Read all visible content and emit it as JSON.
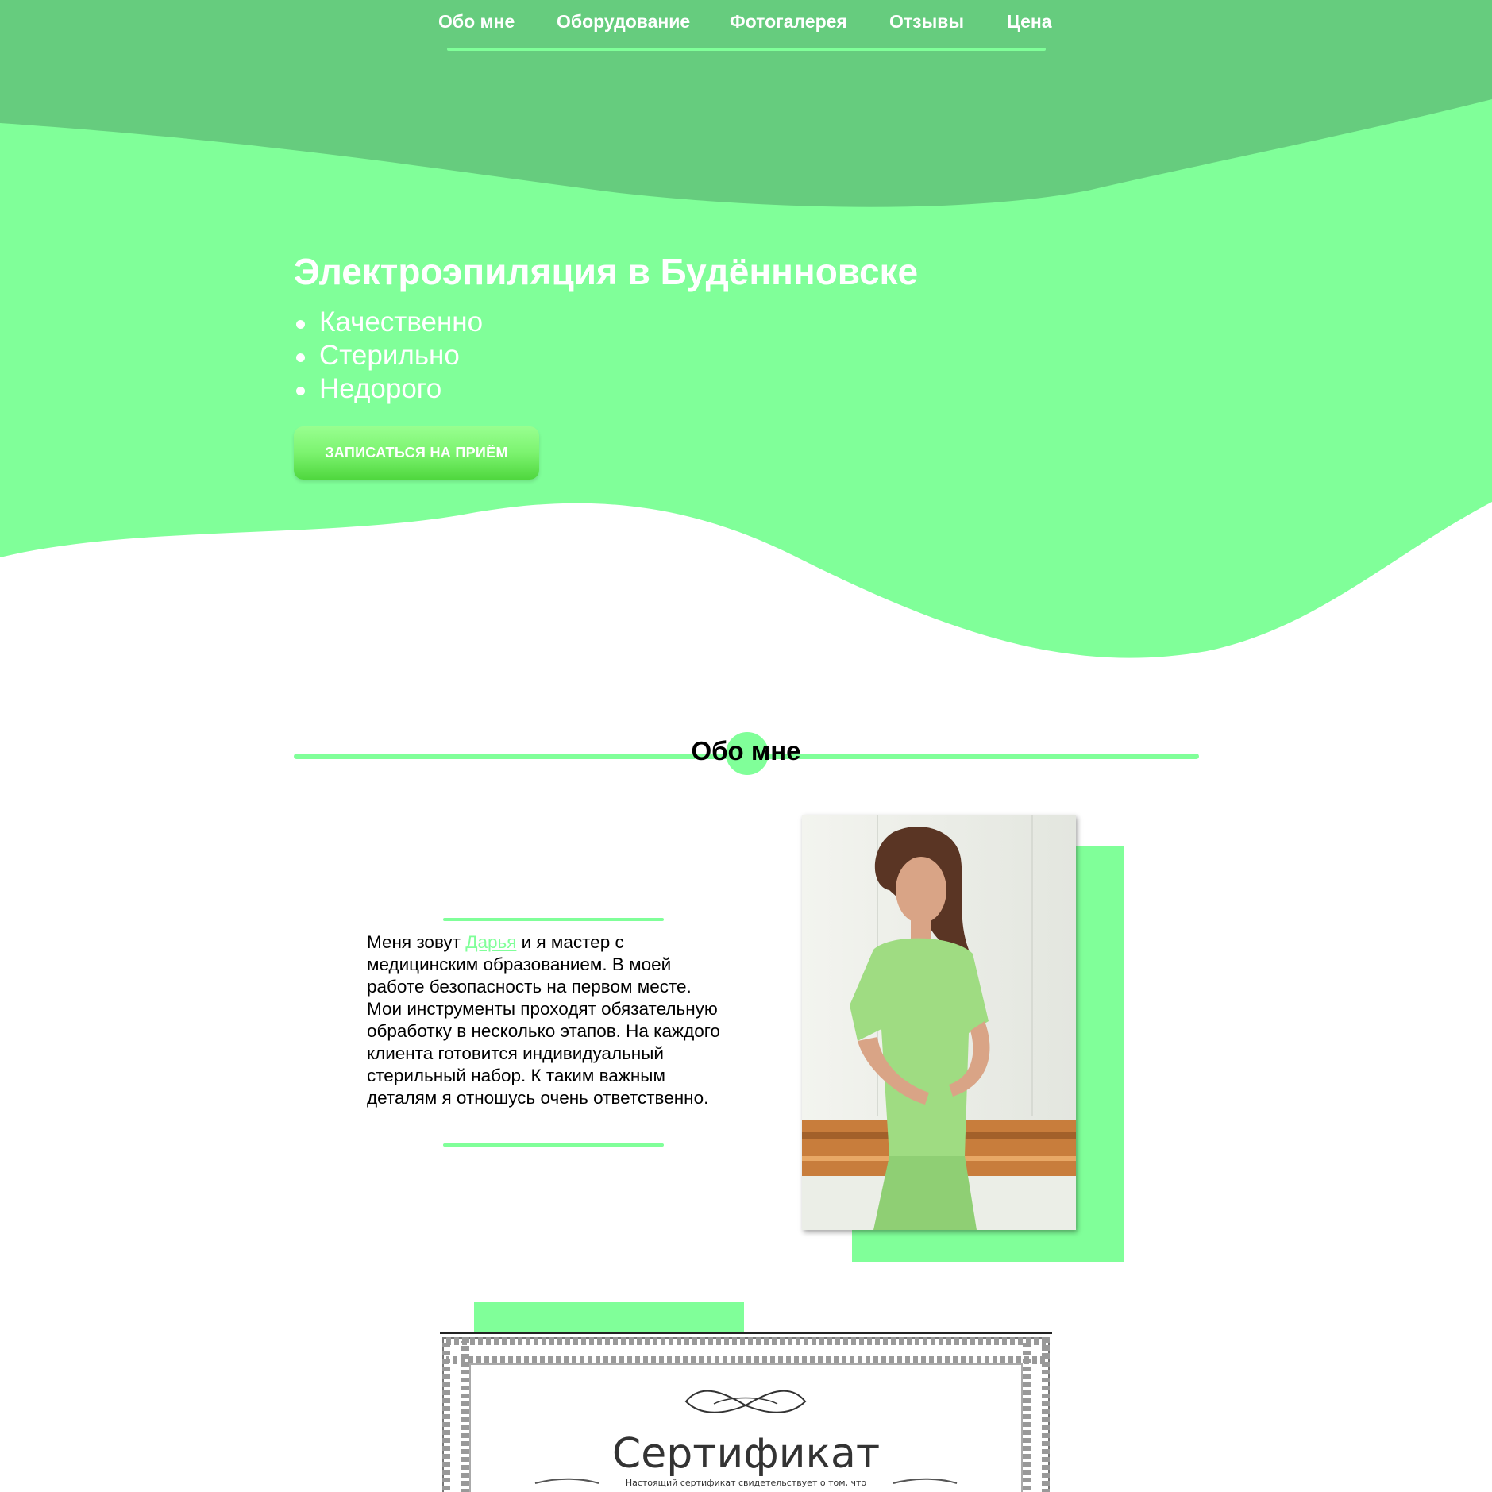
{
  "colors": {
    "accent": "#80ff99",
    "header_dark": "#66cc7e",
    "button_gradient_bottom": "#4fd73e",
    "text_white": "#ffffff",
    "text_dark": "#000000"
  },
  "nav": {
    "items": [
      {
        "label": "Обо мне"
      },
      {
        "label": "Оборудование"
      },
      {
        "label": "Фотогалерея"
      },
      {
        "label": "Отзывы"
      },
      {
        "label": "Цена"
      }
    ]
  },
  "hero": {
    "title": "Электроэпиляция в Будённновске",
    "bullets": [
      "Качественно",
      "Стерильно",
      "Недорого"
    ],
    "cta_label": "ЗАПИСАТЬСЯ НА ПРИЁМ"
  },
  "about": {
    "section_title": "Обо мне",
    "text_before": "Меня зовут ",
    "name_link": "Дарья",
    "text_after": " и я мастер с медицинским образованием. В моей работе безопасность на первом месте. Мои инструменты проходят обязательную обработку в несколько этапов. На каждого клиента готовится индивидуальный стерильный набор. К таким важным деталям я отношусь очень ответственно."
  },
  "certificate": {
    "title": "Сертификат",
    "subtitle": "Настоящий сертификат свидетельствует о том, что"
  }
}
